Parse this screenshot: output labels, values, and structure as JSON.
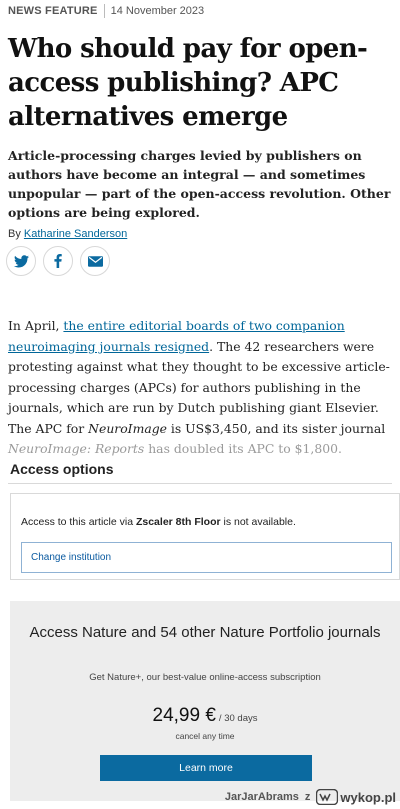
{
  "meta": {
    "kind": "NEWS FEATURE",
    "date": "14 November 2023"
  },
  "headline": "Who should pay for open-access publishing? APC alternatives emerge",
  "standfirst": "Article-processing charges levied by publishers on authors have become an integral — and sometimes unpopular — part of the open-access revolution. Other options are being explored.",
  "byline": {
    "prefix": "By",
    "author": "Katharine Sanderson"
  },
  "share": [
    {
      "icon": "twitter-icon"
    },
    {
      "icon": "facebook-icon"
    },
    {
      "icon": "email-icon"
    }
  ],
  "body": {
    "p1_start": "In April, ",
    "p1_link": "the entire editorial boards of two companion neuroimaging journals resigned",
    "p1_mid": ". The 42 researchers were protesting against what they thought to be excessive article-processing charges (APCs) for authors publishing in the journals, which are run by Dutch publishing giant Elsevier. The APC for ",
    "journal1": "NeuroImage",
    "p1_mid2": " is US$3,450, and its sister journal ",
    "journal2": "NeuroImage: Reports",
    "p1_end": " has doubled its APC to $1,800."
  },
  "access": {
    "title": "Access options",
    "institution_prefix": "Access to this article via ",
    "institution": "Zscaler 8th Floor",
    "institution_suffix": " is not available.",
    "change_label": "Change institution"
  },
  "subscription": {
    "title": "Access Nature and 54 other Nature Portfolio journals",
    "description": "Get Nature+, our best-value online-access subscription",
    "price": "24,99 €",
    "period": "/ 30 days",
    "cancel": "cancel any time",
    "button": "Learn more"
  },
  "watermark": {
    "user": "JarJarAbrams",
    "via": "z",
    "site": "wykop.pl"
  },
  "colors": {
    "link": "#006699",
    "button": "#0b6aa0",
    "panel": "#ededed"
  }
}
